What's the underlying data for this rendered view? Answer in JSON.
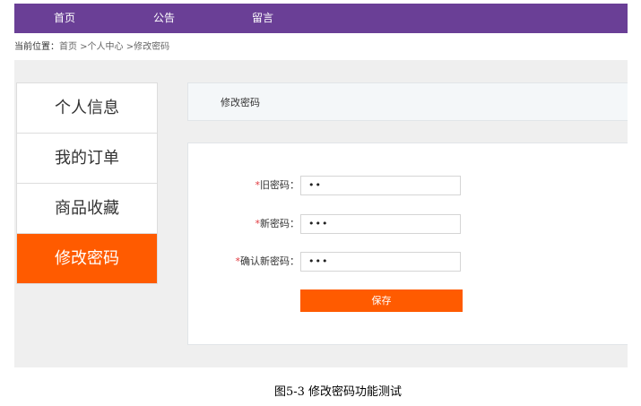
{
  "topnav": {
    "items": [
      {
        "label": "首页"
      },
      {
        "label": "公告"
      },
      {
        "label": "留言"
      }
    ]
  },
  "breadcrumb": {
    "prefix": "当前位置：",
    "path": "首页 >个人中心 >修改密码"
  },
  "sidebar": {
    "items": [
      {
        "label": "个人信息",
        "active": false
      },
      {
        "label": "我的订单",
        "active": false
      },
      {
        "label": "商品收藏",
        "active": false
      },
      {
        "label": "修改密码",
        "active": true
      }
    ]
  },
  "panel": {
    "title": "修改密码"
  },
  "form": {
    "required_mark": "*",
    "old_password": {
      "label": "旧密码：",
      "value": "••"
    },
    "new_password": {
      "label": "新密码：",
      "value": "•••"
    },
    "confirm_password": {
      "label": "确认新密码：",
      "value": "•••"
    },
    "save_label": "保存"
  },
  "caption": "图5-3 修改密码功能测试",
  "colors": {
    "nav_bg": "#6a3f96",
    "accent": "#ff5b00",
    "content_bg": "#efefef",
    "required": "#e0383e"
  }
}
